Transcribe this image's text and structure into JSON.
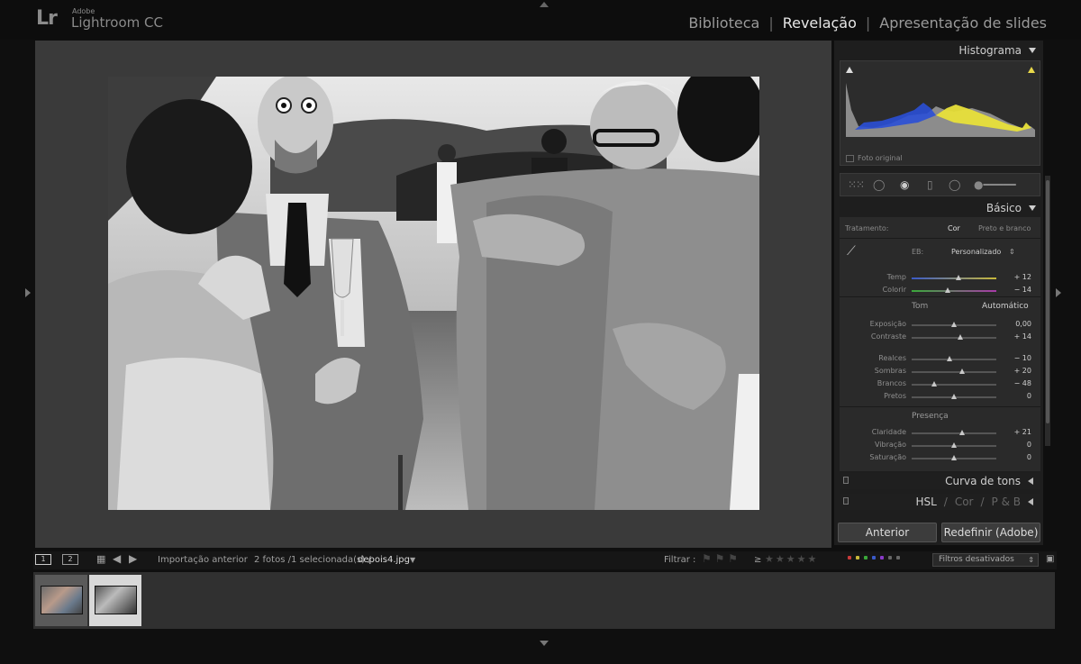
{
  "app": {
    "logo_mark": "Lr",
    "vendor": "Adobe",
    "name": "Lightroom CC"
  },
  "modules": [
    {
      "label": "Biblioteca",
      "active": false
    },
    {
      "label": "Revelação",
      "active": true
    },
    {
      "label": "Apresentação de slides",
      "active": false
    }
  ],
  "module_separator": "|",
  "histogram": {
    "title": "Histograma",
    "original_photo_label": "Foto original"
  },
  "basic": {
    "title": "Básico",
    "treatment_label": "Tratamento:",
    "treatment_color": "Cor",
    "treatment_bw": "Preto e branco",
    "wb_label": "EB:",
    "wb_value": "Personalizado",
    "tone_label": "Tom",
    "tone_auto": "Automático",
    "presence_label": "Presença",
    "sliders": [
      {
        "label": "Temp",
        "value": "+ 12",
        "pos": 0.55
      },
      {
        "label": "Colorir",
        "value": "− 14",
        "pos": 0.43
      },
      {
        "label": "Exposição",
        "value": "0,00",
        "pos": 0.5
      },
      {
        "label": "Contraste",
        "value": "+ 14",
        "pos": 0.57
      },
      {
        "label": "Realces",
        "value": "− 10",
        "pos": 0.45
      },
      {
        "label": "Sombras",
        "value": "+ 20",
        "pos": 0.6
      },
      {
        "label": "Brancos",
        "value": "− 48",
        "pos": 0.27
      },
      {
        "label": "Pretos",
        "value": "0",
        "pos": 0.5
      },
      {
        "label": "Claridade",
        "value": "+ 21",
        "pos": 0.6
      },
      {
        "label": "Vibração",
        "value": "0",
        "pos": 0.5
      },
      {
        "label": "Saturação",
        "value": "0",
        "pos": 0.5
      }
    ]
  },
  "tone_curve": {
    "title": "Curva de tons"
  },
  "hsl": {
    "hsl": "HSL",
    "sep": "/",
    "cor": "Cor",
    "pb": "P & B"
  },
  "buttons": {
    "previous": "Anterior",
    "reset": "Redefinir (Adobe)"
  },
  "filmstrip_bar": {
    "monitor1": "1",
    "monitor2": "2",
    "source": "Importação anterior",
    "count": "2 fotos /1 selecionada(s) /",
    "filename": "depois4.jpg",
    "filter_label": "Filtrar :",
    "filter_select": "Filtros desativados",
    "rating_op": "≥"
  },
  "colors": {
    "accent": "#e6e6e6",
    "panel": "#2a2a2a",
    "histo_blue": "#2a4fd6",
    "histo_yellow": "#e8e03a",
    "label_red": "#c83a3a",
    "label_yellow": "#c8b83a",
    "label_green": "#3aa83a",
    "label_blue": "#3a5ac8",
    "label_purple": "#8a3ac8"
  }
}
